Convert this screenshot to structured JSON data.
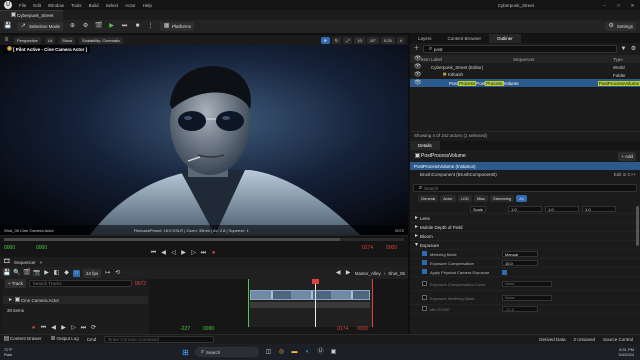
{
  "window": {
    "title": "Cyberpunk_Street",
    "menu": [
      "File",
      "Edit",
      "Window",
      "Tools",
      "Build",
      "Select",
      "Actor",
      "Help"
    ],
    "tab": "Cyberpunk_Street"
  },
  "toolbar": {
    "selection_mode": "Selection Mode",
    "platforms": "Platforms",
    "settings": "Settings"
  },
  "viewport": {
    "perspective": "Perspective",
    "lit": "Lit",
    "show": "Show",
    "scalability": "Scalability: Cinematic",
    "pilot": "[ Pilot Active - Cine Camera Actor ]",
    "grid_1": "10",
    "grid_2": "10°",
    "grid_3": "0.25",
    "fov": "4",
    "cam_left": "Shot_05 Cine Camera Actor",
    "cam_info": "FilmbackPreset: 16:9 DSLR | Zoom: 35mm | Av: 2.8 | Squeeze: 1",
    "frame": "0072",
    "scrub_left": "0000",
    "scrub_mid": "0000",
    "scrub_r1": "0174",
    "scrub_r2": "0000"
  },
  "sequencer": {
    "tab": "Sequencer",
    "close": "×",
    "fps": "24 fps",
    "breadcrumb_1": "Master_Alley",
    "breadcrumb_2": "Shot_05",
    "add_track": "+ Track",
    "search": "Search Tracks",
    "frame": "0072",
    "track": "Cine Camera Actor",
    "items": "20 items",
    "time_left": "-227",
    "time_mid": "0000",
    "time_r1": "0174",
    "time_r2": "0000"
  },
  "bottom": {
    "content_drawer": "Content Drawer",
    "output_log": "Output Log",
    "cmd": "Cmd",
    "console": "Enter Console Command",
    "derived": "Derived Data",
    "unsaved": "2 Unsaved",
    "source": "Source Control"
  },
  "taskbar": {
    "search": "Search",
    "temp": "72°F",
    "weather": "Rain",
    "time": "5:31 PM",
    "date": "3/4/2024"
  },
  "outliner": {
    "tabs": [
      "Layers",
      "Content Browser",
      "Outliner"
    ],
    "search": "post",
    "col_label": "Item Label",
    "col_seq": "Sequencer",
    "col_type": "Type",
    "rows": [
      {
        "label": "Cyberpunk_Street (Editor)",
        "type": "World"
      },
      {
        "label": "Kitbash",
        "type": "Folder"
      },
      {
        "pre": "Post",
        "hl": "Process",
        "mid": "Post",
        "hl2": "Process",
        "post": "Volume",
        "type": "PostProcessVolume"
      }
    ],
    "status": "Showing 4 of 242 actors (1 selected)"
  },
  "details": {
    "tab": "Details",
    "title": "PostProcessVolume",
    "add": "+ Add",
    "instance": "PostProcessVolume (Instance)",
    "component": "BrushComponent (BrushComponent0)",
    "edit": "Edit in C++",
    "search": "Search",
    "filters": [
      "General",
      "Actor",
      "LOD",
      "Misc",
      "Streaming",
      "All"
    ],
    "scale_label": "Scale",
    "scale": [
      "1.0",
      "1.0",
      "1.0"
    ],
    "sections": [
      "Lens",
      "Mobile Depth of Field",
      "Bloom",
      "Exposure"
    ],
    "props": [
      {
        "label": "Metering Mode",
        "value": "Manual",
        "checked": true
      },
      {
        "label": "Exposure Compensation",
        "value": "10.0",
        "checked": true
      },
      {
        "label": "Apply Physical Camera Exposure",
        "value": "",
        "checked": true
      },
      {
        "label": "Exposure Compensation Curve",
        "value": "None",
        "checked": false
      },
      {
        "label": "Exposure Metering Mask",
        "value": "None",
        "checked": false
      },
      {
        "label": "Min EV100",
        "value": "-10.0",
        "checked": false
      }
    ],
    "colors": {
      "accent": "#2d6bb3",
      "highlight": "#b6cb3a",
      "play": "#4cc94c"
    }
  }
}
